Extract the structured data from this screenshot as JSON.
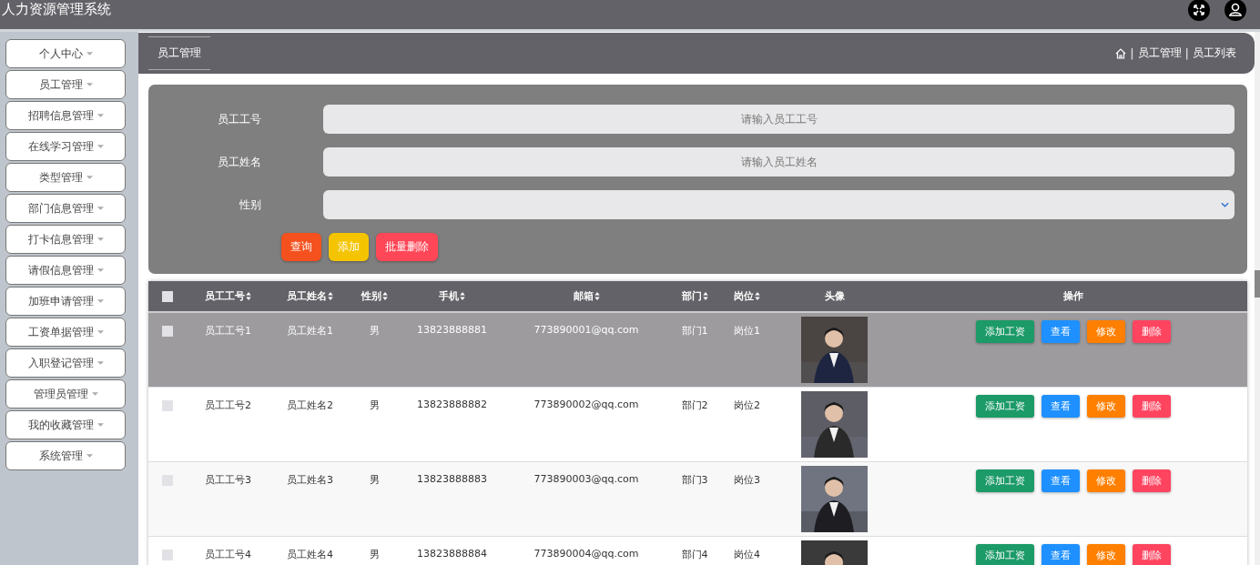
{
  "header": {
    "title": "人力资源管理系统"
  },
  "sidebar": {
    "items": [
      {
        "label": "个人中心"
      },
      {
        "label": "员工管理"
      },
      {
        "label": "招聘信息管理"
      },
      {
        "label": "在线学习管理"
      },
      {
        "label": "类型管理"
      },
      {
        "label": "部门信息管理"
      },
      {
        "label": "打卡信息管理"
      },
      {
        "label": "请假信息管理"
      },
      {
        "label": "加班申请管理"
      },
      {
        "label": "工资单据管理"
      },
      {
        "label": "入职登记管理"
      },
      {
        "label": "管理员管理"
      },
      {
        "label": "我的收藏管理"
      },
      {
        "label": "系统管理"
      }
    ]
  },
  "tab": {
    "label": "员工管理"
  },
  "breadcrumb": [
    {
      "kind": "separator",
      "text": "|"
    },
    {
      "kind": "link",
      "text": "员工管理"
    },
    {
      "kind": "separator",
      "text": "|"
    },
    {
      "kind": "link",
      "text": "员工列表"
    }
  ],
  "search": {
    "fields": [
      {
        "kind": "input",
        "label": "员工工号",
        "placeholder": "请输入员工工号"
      },
      {
        "kind": "input",
        "label": "员工姓名",
        "placeholder": "请输入员工姓名"
      },
      {
        "kind": "select",
        "label": "性别"
      }
    ],
    "buttons": [
      {
        "label": "查询",
        "color": "#f4511e"
      },
      {
        "label": "添加",
        "color": "#f5c400"
      },
      {
        "label": "批量删除",
        "color": "#ff4757"
      }
    ]
  },
  "table": {
    "select_all": {
      "checked": false
    },
    "columns": [
      {
        "label": "员工工号",
        "sortable": true
      },
      {
        "label": "员工姓名",
        "sortable": true
      },
      {
        "label": "性别",
        "sortable": true
      },
      {
        "label": "手机",
        "sortable": true
      },
      {
        "label": "邮箱",
        "sortable": true
      },
      {
        "label": "部门",
        "sortable": true
      },
      {
        "label": "岗位",
        "sortable": true
      },
      {
        "label": "头像",
        "sortable": false
      },
      {
        "label": "操作",
        "sortable": false
      }
    ],
    "rows": [
      {
        "highlighted": true,
        "checked": false,
        "cells": [
          "员工工号1",
          "员工姓名1",
          "男",
          "13823888881",
          "773890001@qq.com",
          "部门1",
          "岗位1"
        ],
        "actions": [
          {
            "label": "添加工资",
            "color": "#1c9a68"
          },
          {
            "label": "查看",
            "color": "#1e90ff"
          },
          {
            "label": "修改",
            "color": "#ff7f00"
          },
          {
            "label": "删除",
            "color": "#ff4460"
          }
        ]
      },
      {
        "highlighted": false,
        "checked": false,
        "cells": [
          "员工工号2",
          "员工姓名2",
          "男",
          "13823888882",
          "773890002@qq.com",
          "部门2",
          "岗位2"
        ],
        "actions": [
          {
            "label": "添加工资",
            "color": "#1c9a68"
          },
          {
            "label": "查看",
            "color": "#1e90ff"
          },
          {
            "label": "修改",
            "color": "#ff7f00"
          },
          {
            "label": "删除",
            "color": "#ff4460"
          }
        ]
      },
      {
        "highlighted": false,
        "checked": false,
        "cells": [
          "员工工号3",
          "员工姓名3",
          "男",
          "13823888883",
          "773890003@qq.com",
          "部门3",
          "岗位3"
        ],
        "actions": [
          {
            "label": "添加工资",
            "color": "#1c9a68"
          },
          {
            "label": "查看",
            "color": "#1e90ff"
          },
          {
            "label": "修改",
            "color": "#ff7f00"
          },
          {
            "label": "删除",
            "color": "#ff4460"
          }
        ]
      },
      {
        "highlighted": false,
        "checked": false,
        "cells": [
          "员工工号4",
          "员工姓名4",
          "男",
          "13823888884",
          "773890004@qq.com",
          "部门4",
          "岗位4"
        ],
        "actions": [
          {
            "label": "添加工资",
            "color": "#1c9a68"
          },
          {
            "label": "查看",
            "color": "#1e90ff"
          },
          {
            "label": "修改",
            "color": "#ff7f00"
          },
          {
            "label": "删除",
            "color": "#ff4460"
          }
        ]
      }
    ]
  }
}
